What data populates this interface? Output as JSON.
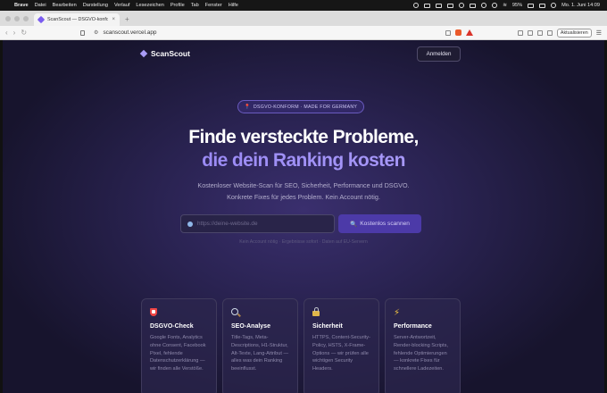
{
  "menubar": {
    "app": "Brave",
    "items": [
      "Datei",
      "Bearbeiten",
      "Darstellung",
      "Verlauf",
      "Lesezeichen",
      "Profile",
      "Tab",
      "Fenster",
      "Hilfe"
    ],
    "battery": "95%",
    "datetime": "Mo. 1. Juni 14:09"
  },
  "browser": {
    "tab_title": "ScanScout — DSGVO-konform",
    "tab_close": "×",
    "new_tab": "+",
    "url": "scanscout.vercel.app",
    "update_label": "Aktualisieren"
  },
  "site": {
    "logo": "ScanScout",
    "login_label": "Anmelden",
    "badge": "DSGVO-KONFORM · MADE FOR GERMANY",
    "headline_line1": "Finde versteckte Probleme,",
    "headline_line2": "die dein Ranking kosten",
    "subline_line1": "Kostenloser Website-Scan für SEO, Sicherheit, Performance und DSGVO.",
    "subline_line2": "Konkrete Fixes für jedes Problem. Kein Account nötig.",
    "input_placeholder": "https://deine-website.de",
    "scan_label": "Kostenlos scannen",
    "hint": "Kein Account nötig · Ergebnisse sofort · Daten auf EU-Servern"
  },
  "features": [
    {
      "icon": "shield-icon",
      "title": "DSGVO-Check",
      "desc": "Google Fonts, Analytics ohne Consent, Facebook Pixel, fehlende Datenschutzerklärung — wir finden alle Verstöße."
    },
    {
      "icon": "magnifier-icon",
      "title": "SEO-Analyse",
      "desc": "Title-Tags, Meta-Descriptions, H1-Struktur, Alt-Texte, Lang-Attribut — alles was dein Ranking beeinflusst."
    },
    {
      "icon": "lock-icon",
      "title": "Sicherheit",
      "desc": "HTTPS, Content-Security-Policy, HSTS, X-Frame-Options — wir prüfen alle wichtigen Security Headers."
    },
    {
      "icon": "lightning-icon",
      "title": "Performance",
      "desc": "Server-Antwortzeit, Render-blocking Scripts, fehlende Optimierungen — konkrete Fixes für schnellere Ladezeiten."
    }
  ],
  "colors": {
    "accent": "#9b8cf5",
    "button": "#4c3aa8",
    "background": "#2a2352"
  }
}
